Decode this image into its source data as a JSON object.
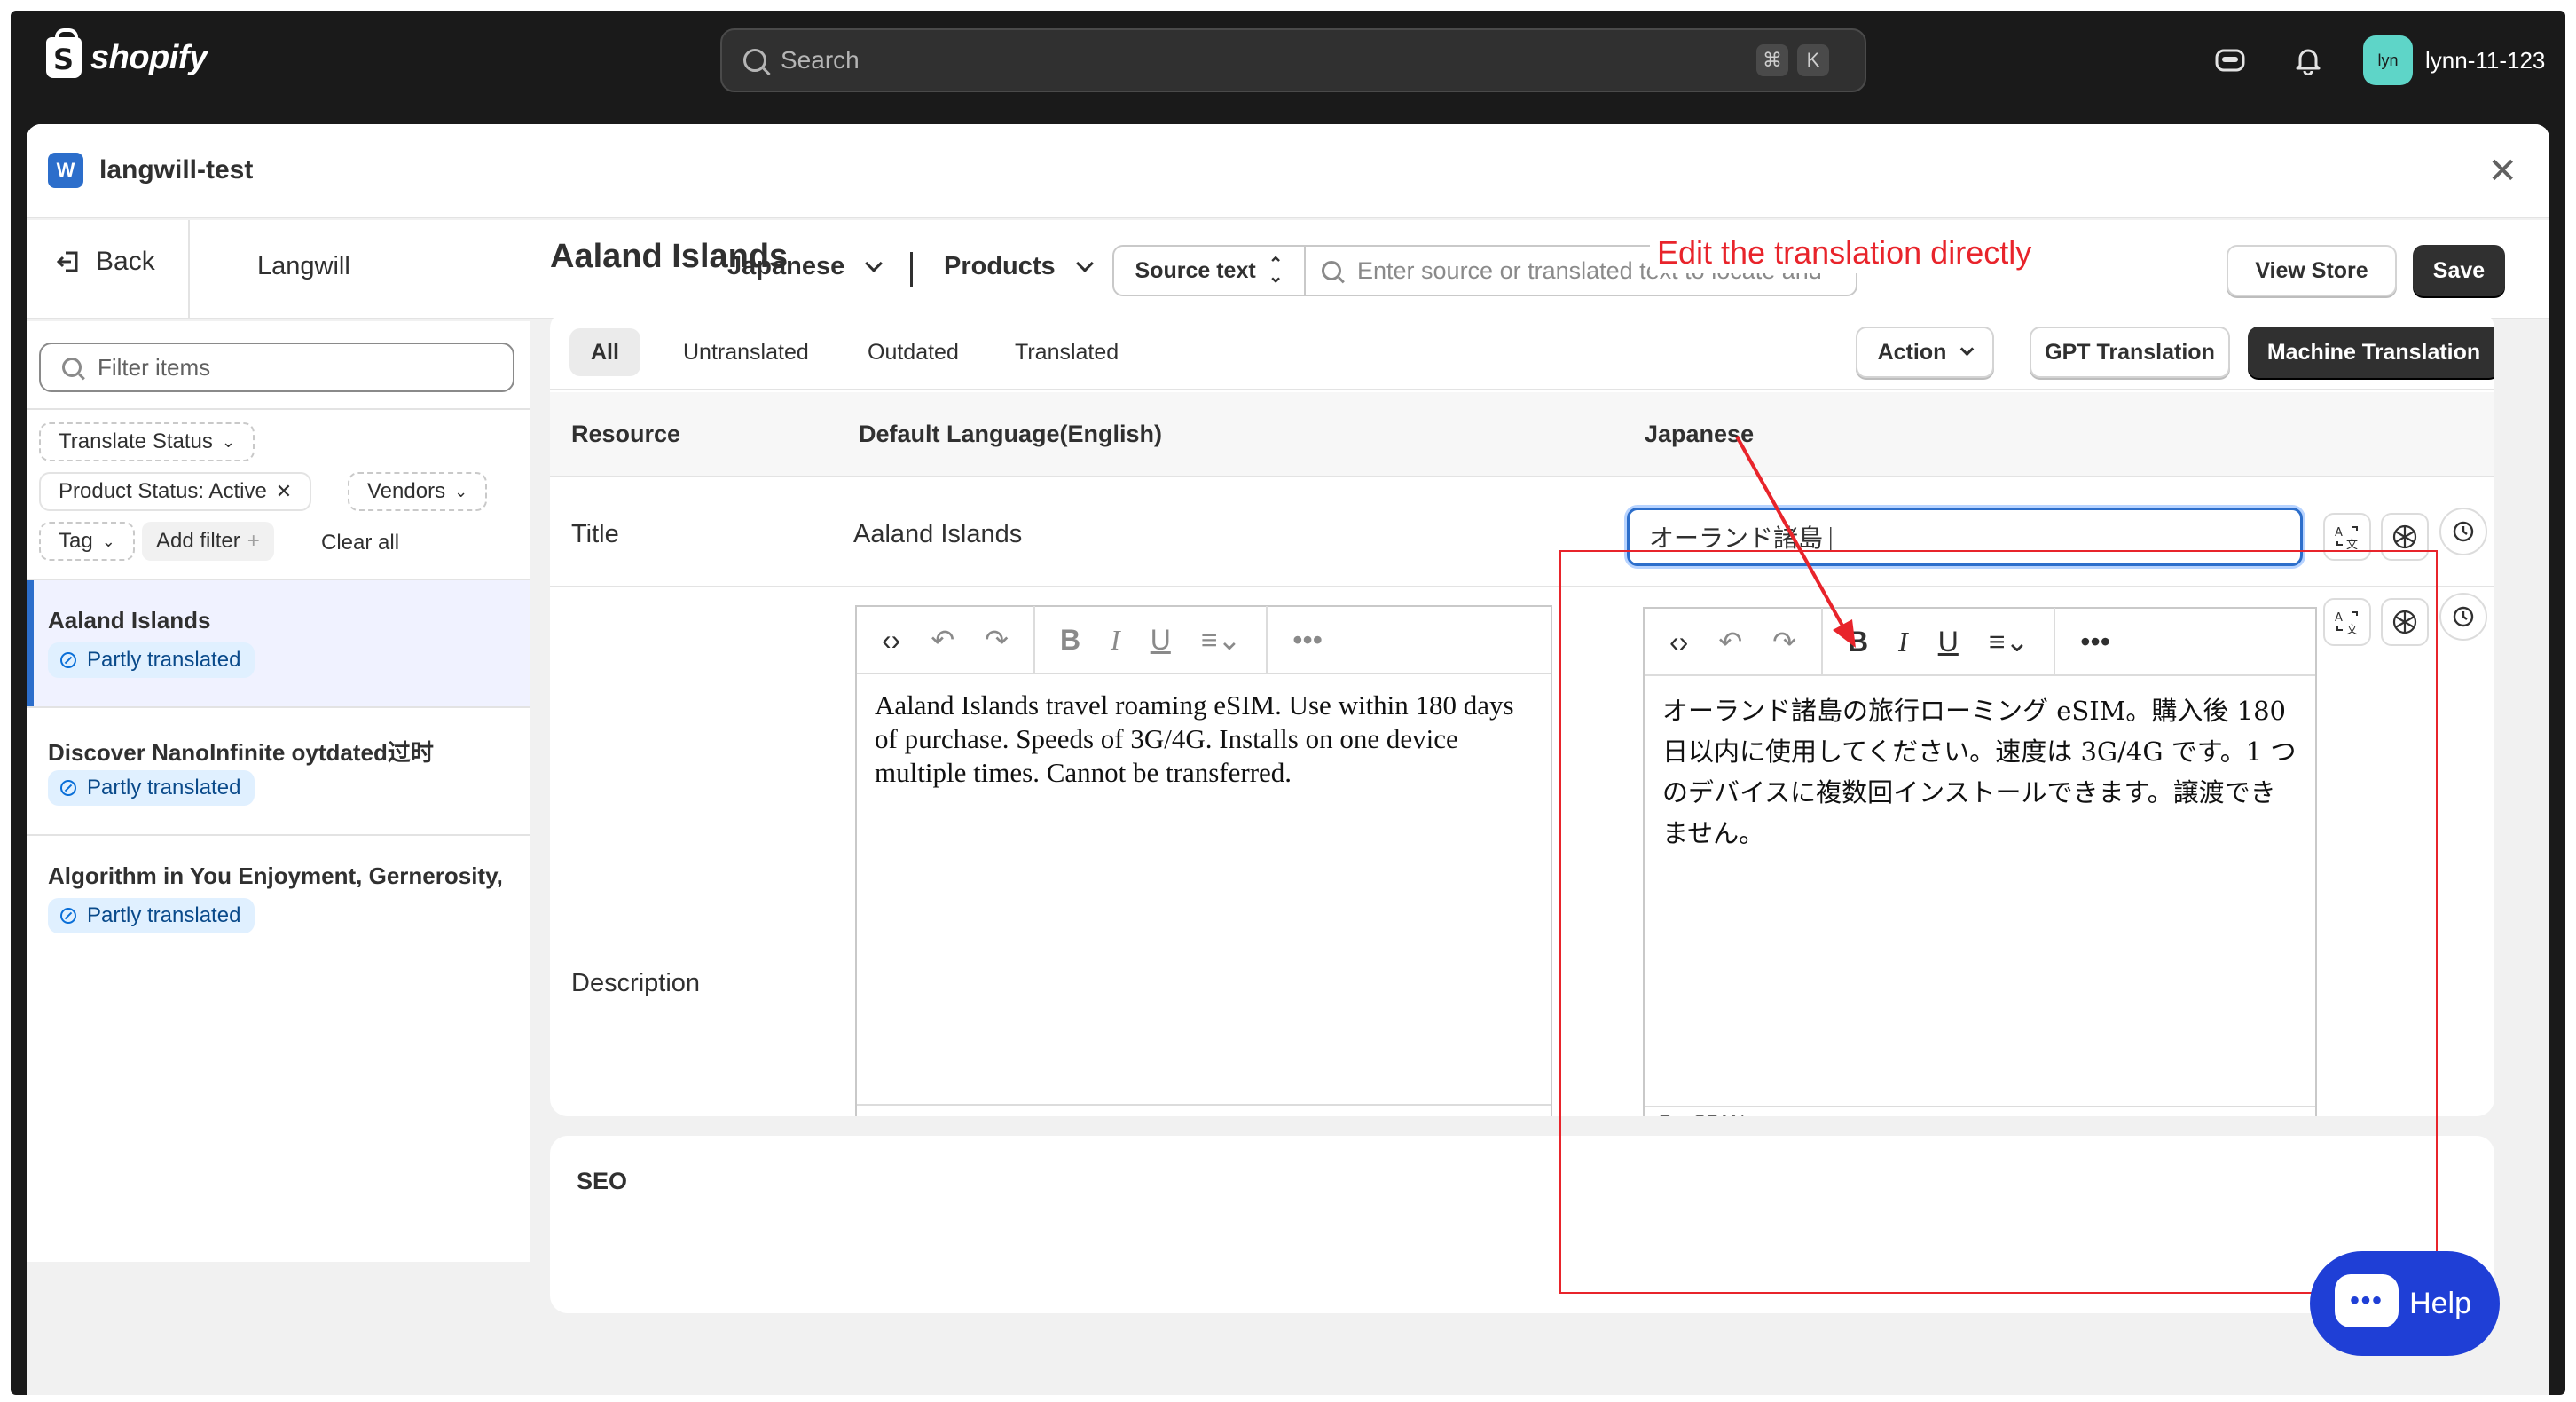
{
  "topbar": {
    "brand": "shopify",
    "search_placeholder": "Search",
    "shortcut_cmd": "⌘",
    "shortcut_key": "K",
    "avatar_initials": "lyn",
    "username": "lynn-11-123"
  },
  "window": {
    "title": "langwill-test",
    "app_logo": "W"
  },
  "toolbar": {
    "back_label": "Back",
    "app_name": "Langwill",
    "language": "Japanese",
    "resource_type": "Products",
    "source_select": "Source text",
    "search_placeholder": "Enter source or translated text to locate and",
    "view_store": "View Store",
    "save": "Save"
  },
  "sidebar": {
    "filter_placeholder": "Filter items",
    "chips": {
      "translate_status": "Translate Status",
      "product_status": "Product Status: Active",
      "vendors": "Vendors",
      "tag": "Tag",
      "add_filter": "Add filter",
      "clear_all": "Clear all"
    },
    "items": [
      {
        "name": "Aaland Islands",
        "status": "Partly translated"
      },
      {
        "name": "Discover NanoInfinite oytdated过时",
        "status": "Partly translated"
      },
      {
        "name": "Algorithm in You Enjoyment, Gernerosity,",
        "status": "Partly translated"
      }
    ]
  },
  "main": {
    "page_title": "Aaland Islands",
    "annotation": "Edit the translation directly",
    "tabs": [
      "All",
      "Untranslated",
      "Outdated",
      "Translated"
    ],
    "actions": {
      "action": "Action",
      "gpt": "GPT Translation",
      "machine": "Machine Translation"
    },
    "columns": {
      "resource": "Resource",
      "default": "Default Language(English)",
      "target": "Japanese"
    },
    "rows": {
      "title_label": "Title",
      "title_source": "Aaland Islands",
      "title_translation": "オーランド諸島",
      "description_label": "Description",
      "description_source": "Aaland Islands travel roaming eSIM. Use within 180 days of purchase. Speeds of 3G/4G. Installs on one device multiple times. Cannot be transferred.",
      "description_translation": "オーランド諸島の旅行ローミング eSIM。購入後 180 日以内に使用してください。速度は 3G/4G です。1 つのデバイスに複数回インストールできます。譲渡できません。",
      "editor_path": "P » SPAN"
    },
    "seo_label": "SEO"
  },
  "help": {
    "label": "Help",
    "bubble": "•••"
  },
  "colors": {
    "accent": "#2c6ecb",
    "annotation": "#e8242b",
    "help": "#1f3fd6"
  }
}
